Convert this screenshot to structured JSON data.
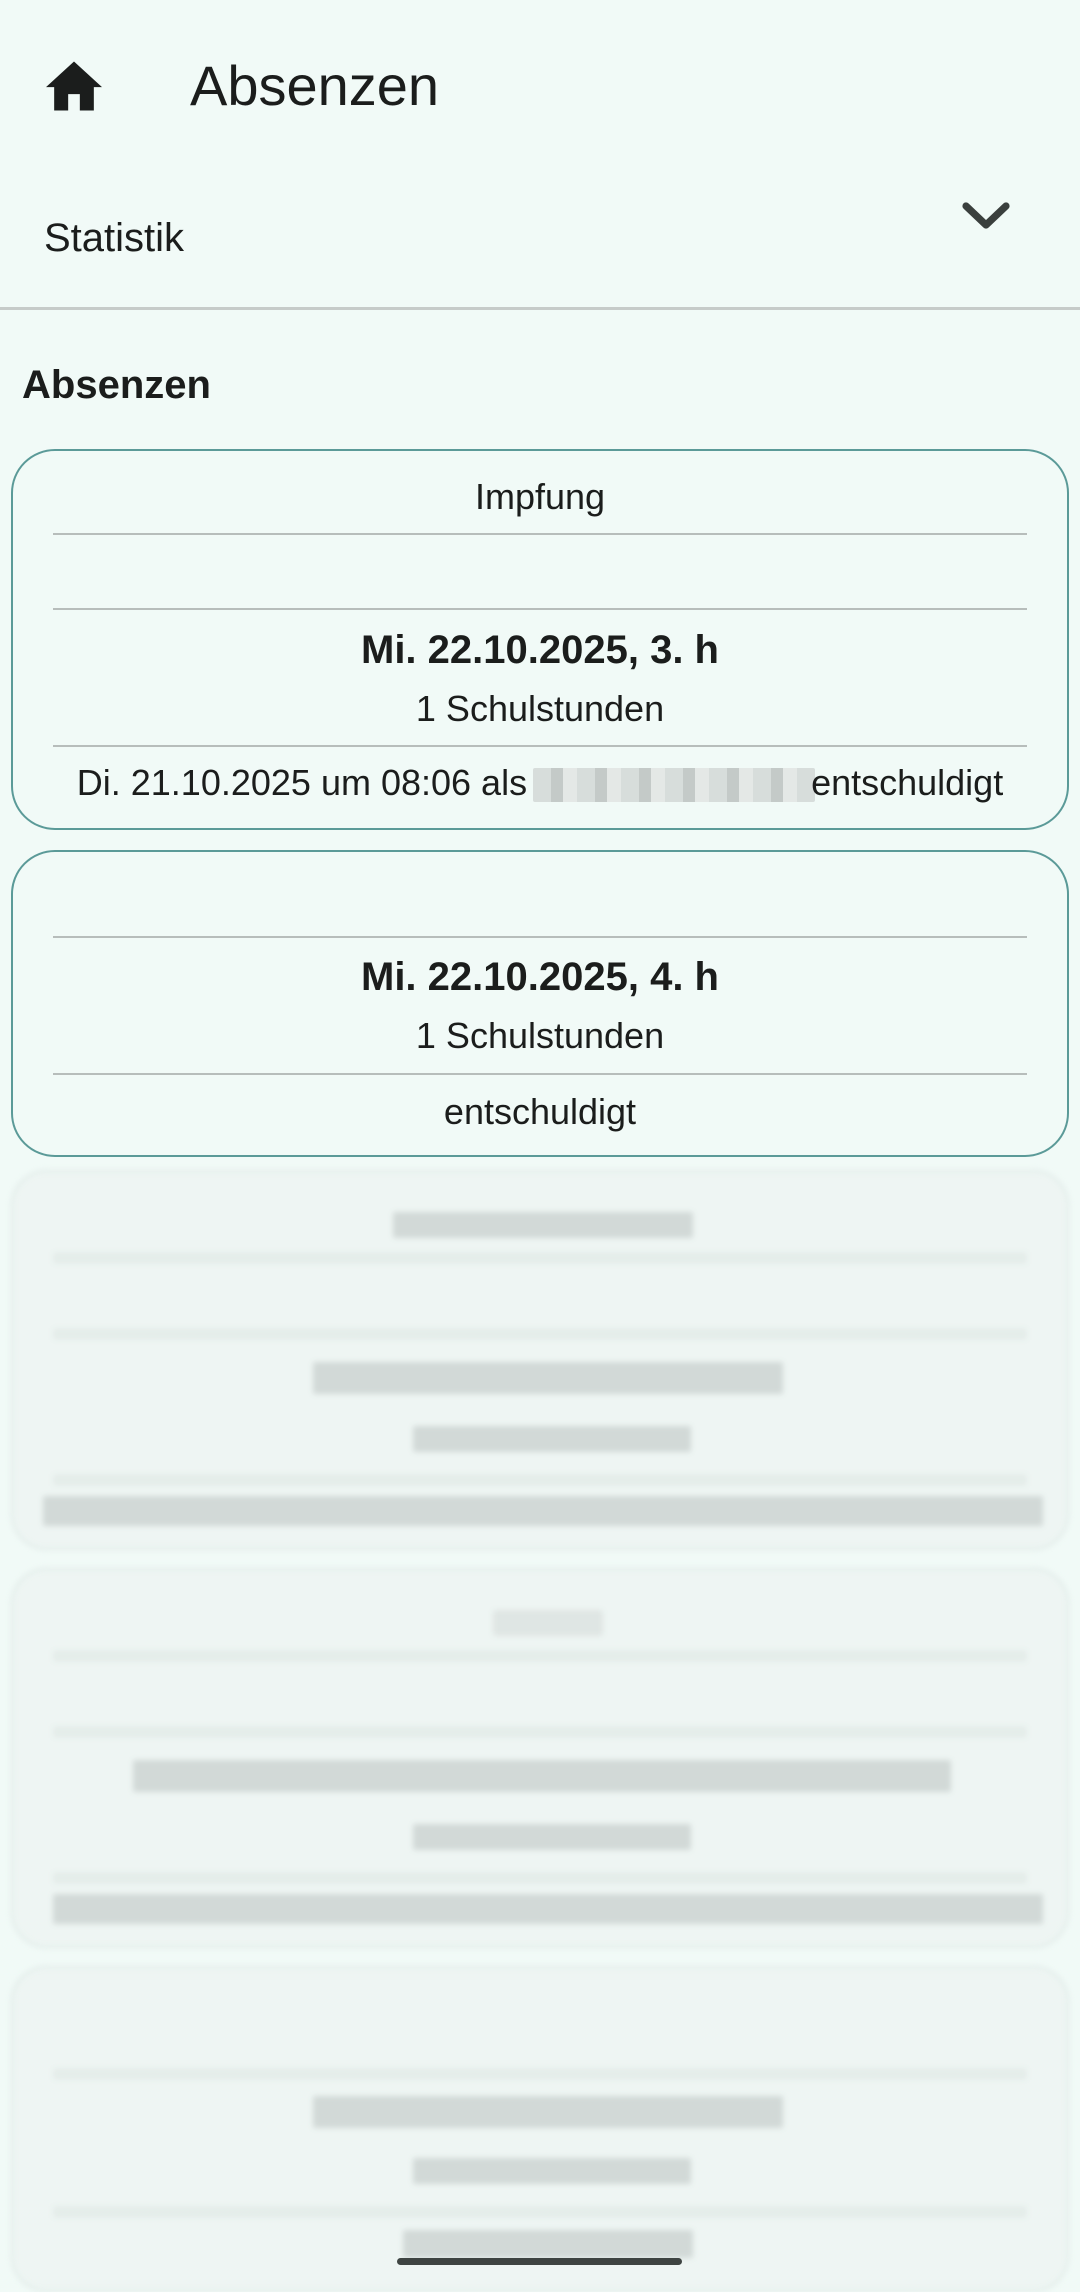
{
  "app_bar": {
    "title": "Absenzen",
    "home_icon": "home-icon"
  },
  "statistics": {
    "label": "Statistik",
    "expand_icon": "chevron-down-icon"
  },
  "section": {
    "title": "Absenzen"
  },
  "absences": [
    {
      "reason": "Impfung",
      "date": "Mi. 22.10.2025, 3. h",
      "count": "1 Schulstunden",
      "status_prefix": "Di. 21.10.2025 um 08:06 als ",
      "status_suffix": "entschuldigt"
    },
    {
      "reason": "",
      "date": "Mi. 22.10.2025, 4. h",
      "count": "1 Schulstunden",
      "status": "entschuldigt"
    }
  ],
  "colors": {
    "background": "#f1faf7",
    "card_border": "#5b9a98",
    "divider": "#b7bdbb",
    "text": "#1b1d1c"
  }
}
